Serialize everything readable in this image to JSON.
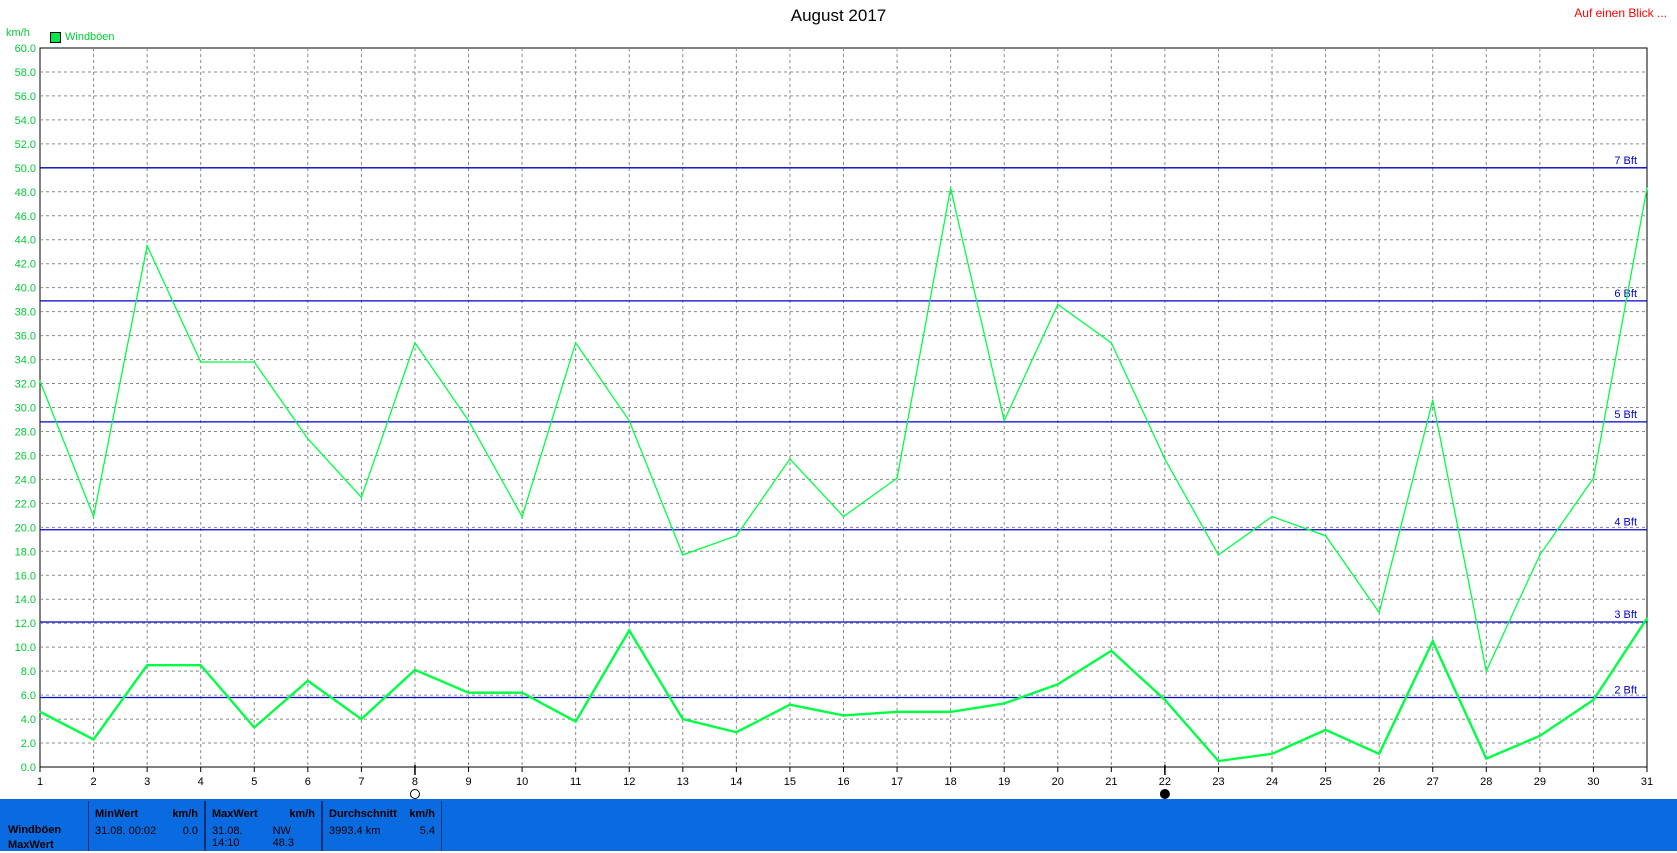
{
  "header": {
    "title": "August 2017",
    "overview_link": "Auf einen Blick ...",
    "unit": "km/h",
    "legend_label": "Windböen"
  },
  "colors": {
    "series": "#00ff44",
    "beaufort_line": "#0000cc",
    "grid": "#888888",
    "panel_bg": "#0a6be0",
    "link": "#ff0000"
  },
  "chart_data": {
    "type": "line",
    "title": "August 2017",
    "ylabel": "km/h",
    "xlabel": "",
    "x": [
      1,
      2,
      3,
      4,
      5,
      6,
      7,
      8,
      9,
      10,
      11,
      12,
      13,
      14,
      15,
      16,
      17,
      18,
      19,
      20,
      21,
      22,
      23,
      24,
      25,
      26,
      27,
      28,
      29,
      30,
      31
    ],
    "xlim": [
      1,
      31
    ],
    "ylim": [
      0,
      60
    ],
    "y_ticks": [
      "0.0",
      "2.0",
      "4.0",
      "6.0",
      "8.0",
      "10.0",
      "12.0",
      "14.0",
      "16.0",
      "18.0",
      "20.0",
      "22.0",
      "24.0",
      "26.0",
      "28.0",
      "30.0",
      "32.0",
      "34.0",
      "36.0",
      "38.0",
      "40.0",
      "42.0",
      "44.0",
      "46.0",
      "48.0",
      "50.0",
      "52.0",
      "54.0",
      "56.0",
      "58.0",
      "60.0"
    ],
    "grid": true,
    "legend": "top-left",
    "series": [
      {
        "name": "Windböen",
        "style": "max",
        "values": [
          32.2,
          20.9,
          43.5,
          33.8,
          33.8,
          27.4,
          22.5,
          35.4,
          28.9,
          20.9,
          35.4,
          28.9,
          17.7,
          19.3,
          25.7,
          20.9,
          24.1,
          48.3,
          28.9,
          38.6,
          35.4,
          25.7,
          17.7,
          20.9,
          19.3,
          12.9,
          30.6,
          8.0,
          17.7,
          24.1,
          48.3
        ]
      },
      {
        "name": "Windböen",
        "style": "mean",
        "values": [
          4.6,
          2.3,
          8.5,
          8.5,
          3.3,
          7.2,
          4.0,
          8.1,
          6.2,
          6.2,
          3.8,
          11.4,
          4.0,
          2.9,
          5.2,
          4.3,
          4.6,
          4.6,
          5.3,
          6.9,
          9.7,
          5.6,
          0.5,
          1.1,
          3.1,
          1.1,
          10.5,
          0.7,
          2.6,
          5.6,
          12.4
        ]
      }
    ],
    "reference_lines": [
      {
        "label": "2 Bft",
        "value": 5.8
      },
      {
        "label": "3 Bft",
        "value": 12.1
      },
      {
        "label": "4 Bft",
        "value": 19.8
      },
      {
        "label": "5 Bft",
        "value": 28.8
      },
      {
        "label": "6 Bft",
        "value": 38.9
      },
      {
        "label": "7 Bft",
        "value": 50.0
      }
    ],
    "moon_phases": [
      {
        "day": 8,
        "phase": "full-moon"
      },
      {
        "day": 22,
        "phase": "new-moon"
      }
    ]
  },
  "stats_panel": {
    "row_labels": [
      "Windböen",
      "MaxWert"
    ],
    "min": {
      "header": "MinWert",
      "unit": "km/h",
      "time": "31.08.  00:02",
      "value": "0.0"
    },
    "max": {
      "header": "MaxWert",
      "unit": "km/h",
      "time": "31.08.  14:10",
      "dir_value": "NW  48.3"
    },
    "avg": {
      "header": "Durchschnitt",
      "unit": "km/h",
      "total": "3993.4 km",
      "value": "5.4"
    }
  }
}
